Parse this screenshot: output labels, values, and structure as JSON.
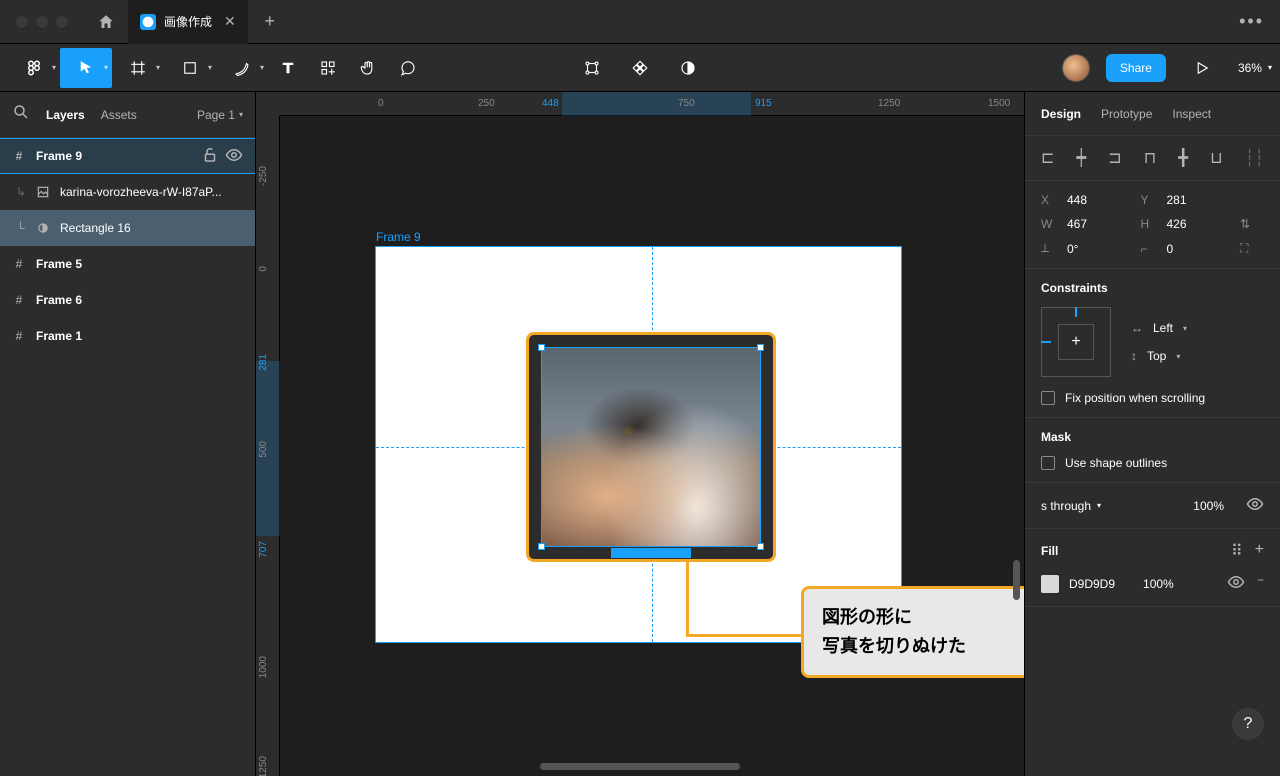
{
  "titlebar": {
    "tab_title": "画像作成"
  },
  "toolbar": {
    "share_label": "Share",
    "zoom": "36%"
  },
  "left_panel": {
    "layers_label": "Layers",
    "assets_label": "Assets",
    "page_label": "Page 1",
    "layers": {
      "frame9": "Frame 9",
      "image": "karina-vorozheeva-rW-I87aP...",
      "rect": "Rectangle 16",
      "frame5": "Frame 5",
      "frame6": "Frame 6",
      "frame1": "Frame 1"
    }
  },
  "right_panel": {
    "tabs": {
      "design": "Design",
      "prototype": "Prototype",
      "inspect": "Inspect"
    },
    "x_label": "X",
    "x_val": "448",
    "y_label": "Y",
    "y_val": "281",
    "w_label": "W",
    "w_val": "467",
    "h_label": "H",
    "h_val": "426",
    "rot_val": "0°",
    "rad_val": "0",
    "constraints_title": "Constraints",
    "constraint_h": "Left",
    "constraint_v": "Top",
    "fix_scroll": "Fix position when scrolling",
    "mask_title": "Mask",
    "mask_outlines": "Use shape outlines",
    "layer_sect": {
      "blend": "s through",
      "opacity": "100%"
    },
    "fill_title": "Fill",
    "fill_hex": "D9D9D9",
    "fill_opacity": "100%"
  },
  "canvas": {
    "frame_label": "Frame 9",
    "ruler_h": {
      "t0": "0",
      "t250": "250",
      "t750": "750",
      "t1250": "1250",
      "t1500": "1500",
      "hl_start": "448",
      "hl_end": "915"
    },
    "ruler_v": {
      "t0": "0",
      "t500": "500",
      "t1000": "1000",
      "t1250": "1250",
      "hl_start": "281",
      "hl_end": "707"
    },
    "annotation_line1": "図形の形に",
    "annotation_line2": "写真を切りぬけた"
  }
}
